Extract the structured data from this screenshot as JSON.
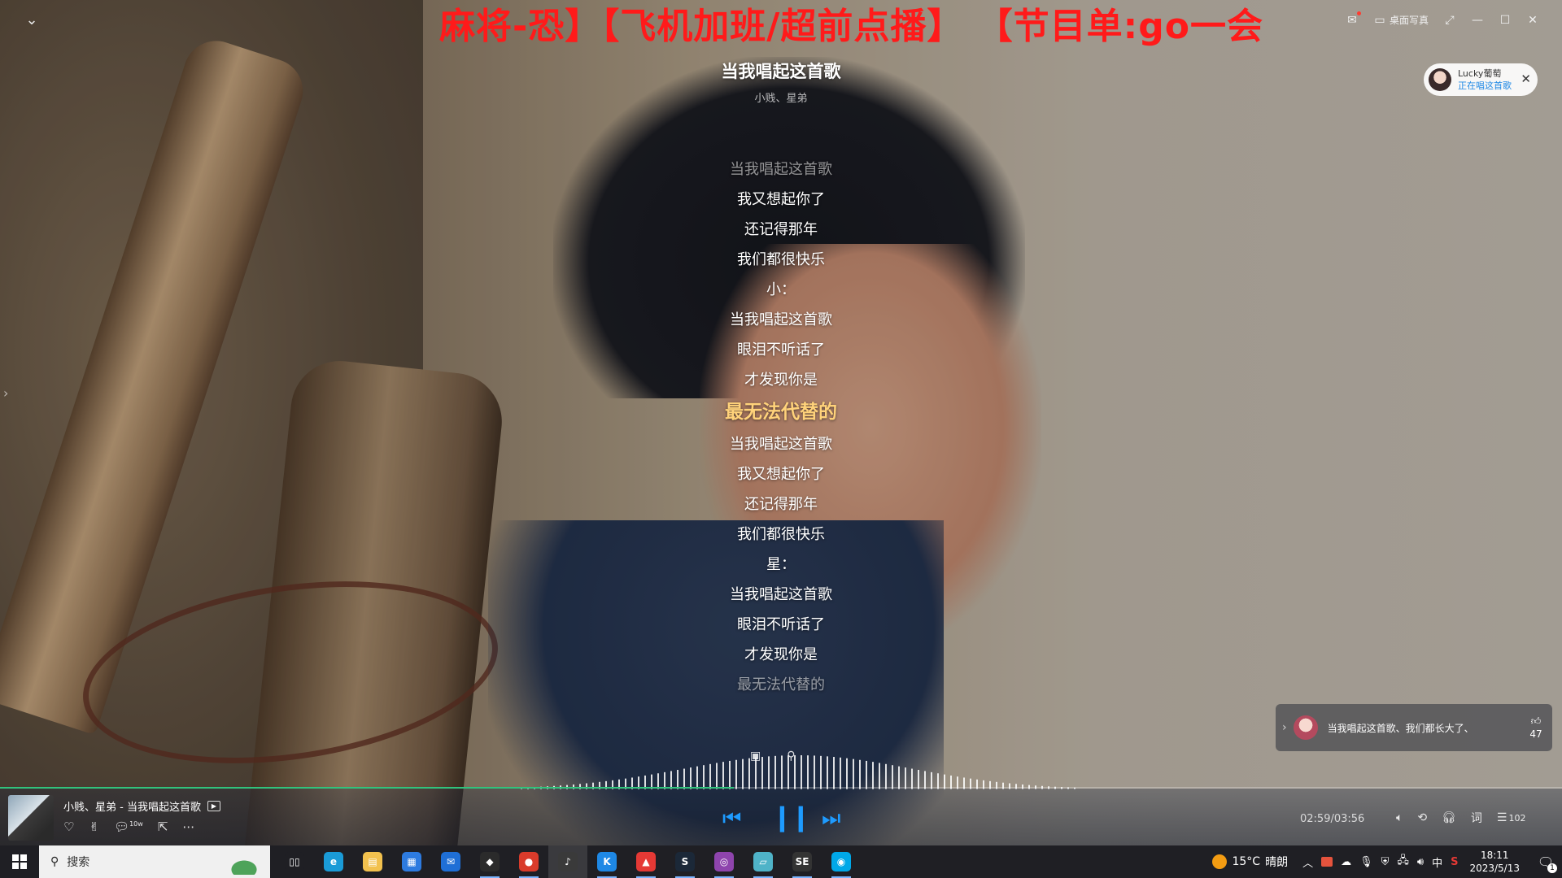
{
  "marquee": "麻将-恐】【飞机加班/超前点播】  【节目单:go一会丿",
  "window": {
    "desk_photo_label": "桌面写真"
  },
  "song": {
    "title": "当我唱起这首歌",
    "artists": "小贱、星弟"
  },
  "lyrics": [
    {
      "text": "当我唱起这首歌",
      "state": "dim"
    },
    {
      "text": "我又想起你了",
      "state": "normal"
    },
    {
      "text": "还记得那年",
      "state": "normal"
    },
    {
      "text": "我们都很快乐",
      "state": "normal"
    },
    {
      "text": "小：",
      "state": "normal"
    },
    {
      "text": "当我唱起这首歌",
      "state": "normal"
    },
    {
      "text": "眼泪不听话了",
      "state": "normal"
    },
    {
      "text": "才发现你是",
      "state": "normal"
    },
    {
      "text": "最无法代替的",
      "state": "active"
    },
    {
      "text": "当我唱起这首歌",
      "state": "normal"
    },
    {
      "text": "我又想起你了",
      "state": "normal"
    },
    {
      "text": "还记得那年",
      "state": "normal"
    },
    {
      "text": "我们都很快乐",
      "state": "normal"
    },
    {
      "text": "星：",
      "state": "normal"
    },
    {
      "text": "当我唱起这首歌",
      "state": "normal"
    },
    {
      "text": "眼泪不听话了",
      "state": "normal"
    },
    {
      "text": "才发现你是",
      "state": "normal"
    },
    {
      "text": "最无法代替的",
      "state": "dim"
    }
  ],
  "singer_card": {
    "name": "Lucky葡萄",
    "status": "正在唱这首歌"
  },
  "comment": {
    "text": "当我唱起这首歌、我们都长大了、",
    "likes": "47"
  },
  "player": {
    "now_playing": "小贱、星弟 - 当我唱起这首歌",
    "time": "02:59/03:56",
    "progress": 0.758,
    "lyrics_btn": "词",
    "playlist_count": "102",
    "count_badge": "10w"
  },
  "taskbar": {
    "search_placeholder": "搜索",
    "weather_temp": "15°C",
    "weather_text": "晴朗",
    "ime": "中",
    "time": "18:11",
    "date": "2023/5/13",
    "notification_count": "1",
    "apps": [
      {
        "name": "task-view",
        "glyph": "▯▯",
        "color": "#1f1f24",
        "state": ""
      },
      {
        "name": "edge",
        "glyph": "e",
        "color": "#1a9bd7",
        "state": ""
      },
      {
        "name": "file-explorer",
        "glyph": "▤",
        "color": "#f2c14e",
        "state": ""
      },
      {
        "name": "store",
        "glyph": "▦",
        "color": "#2d7be0",
        "state": ""
      },
      {
        "name": "mail",
        "glyph": "✉",
        "color": "#1f6fd6",
        "state": ""
      },
      {
        "name": "binance",
        "glyph": "◆",
        "color": "#2b2b2b",
        "state": "running"
      },
      {
        "name": "chrome",
        "glyph": "●",
        "color": "#d93b2b",
        "state": "running"
      },
      {
        "name": "music-player",
        "glyph": "♪",
        "color": "#3a3a3a",
        "state": "active"
      },
      {
        "name": "kugou",
        "glyph": "K",
        "color": "#1e88e5",
        "state": "running"
      },
      {
        "name": "app-red",
        "glyph": "▲",
        "color": "#e53935",
        "state": "running"
      },
      {
        "name": "steam",
        "glyph": "S",
        "color": "#1b2838",
        "state": "running"
      },
      {
        "name": "app-purple",
        "glyph": "◎",
        "color": "#8e44ad",
        "state": "running"
      },
      {
        "name": "app-cyan",
        "glyph": "▱",
        "color": "#4fb3c8",
        "state": "running"
      },
      {
        "name": "se-app",
        "glyph": "SE",
        "color": "#333",
        "state": "running"
      },
      {
        "name": "app-blue",
        "glyph": "◉",
        "color": "#00a8e8",
        "state": "running"
      }
    ]
  }
}
